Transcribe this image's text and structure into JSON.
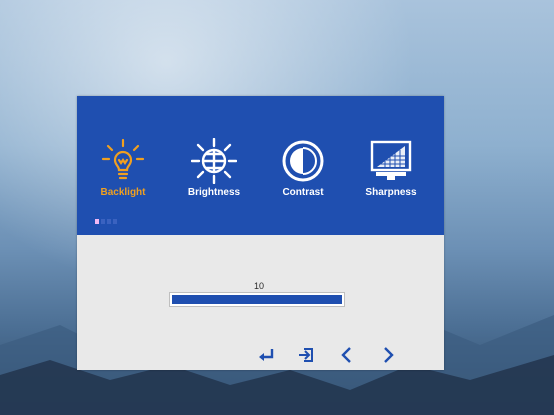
{
  "osd": {
    "menu": [
      {
        "id": "backlight",
        "label": "Backlight",
        "icon": "bulb-icon",
        "active": true
      },
      {
        "id": "brightness",
        "label": "Brightness",
        "icon": "sun-icon",
        "active": false
      },
      {
        "id": "contrast",
        "label": "Contrast",
        "icon": "contrast-icon",
        "active": false
      },
      {
        "id": "sharpness",
        "label": "Sharpness",
        "icon": "monitor-icon",
        "active": false
      }
    ],
    "page_indicator": {
      "count": 4,
      "active_index": 0
    },
    "slider": {
      "value": "10",
      "level_percent": 100
    },
    "nav_buttons": [
      {
        "id": "enter",
        "icon": "enter-icon"
      },
      {
        "id": "exit",
        "icon": "exit-icon"
      },
      {
        "id": "left",
        "icon": "chevron-left-icon"
      },
      {
        "id": "right",
        "icon": "chevron-right-icon"
      }
    ],
    "colors": {
      "header_blue": "#1f4fb0",
      "active_orange": "#f0a020",
      "panel_gray": "#e9e9e9",
      "dot_active": "#f2b8f4"
    }
  }
}
